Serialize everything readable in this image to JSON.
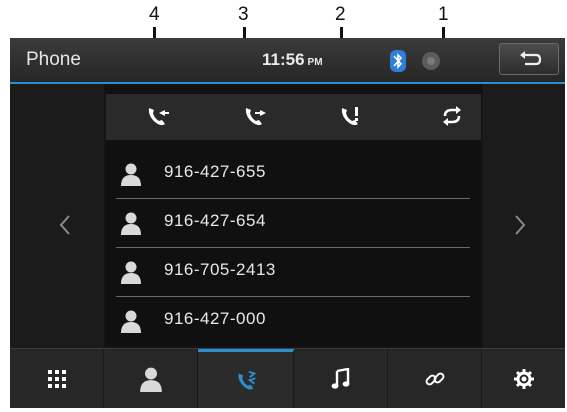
{
  "callouts": [
    "4",
    "3",
    "2",
    "1"
  ],
  "header": {
    "title": "Phone",
    "time": "11:56",
    "ampm": "PM"
  },
  "icons": {
    "bluetooth": "bluetooth-icon",
    "record": "record-icon",
    "back": "back-arrow-icon",
    "recent_incoming": "incoming-call-icon",
    "recent_outgoing": "outgoing-call-icon",
    "missed": "missed-call-icon",
    "sync": "sync-icon"
  },
  "contacts": [
    "916-427-655",
    "916-427-654",
    "916-705-2413",
    "916-427-000"
  ],
  "bottom_tabs": [
    "keypad-icon",
    "contacts-icon",
    "call-log-icon",
    "music-icon",
    "link-icon",
    "settings-icon"
  ],
  "colors": {
    "accent": "#2a8fd0",
    "background": "#141414",
    "text": "#e8e8e8"
  }
}
